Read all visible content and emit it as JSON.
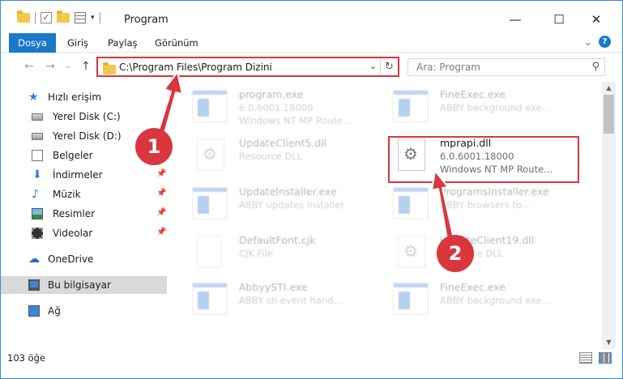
{
  "window": {
    "title": "Program"
  },
  "titlebar": {
    "minimize": "—",
    "maximize": "☐",
    "close": "✕",
    "qat_dropdown": "▾"
  },
  "ribbon": {
    "tabs": [
      "Dosya",
      "Giriş",
      "Paylaş",
      "Görünüm"
    ],
    "expand": "⌄",
    "help": "?"
  },
  "nav": {
    "back": "←",
    "forward": "→",
    "recent": "⌄",
    "up": "↑",
    "address": "C:\\Program Files\\Program Dizini",
    "address_dd": "⌄",
    "refresh": "↻",
    "search_placeholder": "Ara: Program",
    "search_icon": "⚲"
  },
  "sidebar": {
    "quick_access": "Hızlı erişim",
    "items": [
      {
        "label": "Yerel Disk (C:)",
        "pinned": false
      },
      {
        "label": "Yerel Disk (D:)",
        "pinned": false
      },
      {
        "label": "Belgeler",
        "pinned": true
      },
      {
        "label": "İndirmeler",
        "pinned": true
      },
      {
        "label": "Müzik",
        "pinned": true
      },
      {
        "label": "Resimler",
        "pinned": true
      },
      {
        "label": "Videolar",
        "pinned": true
      }
    ],
    "onedrive": "OneDrive",
    "this_pc": "Bu bilgisayar",
    "network": "Ağ",
    "pin_icon": "📌"
  },
  "files": [
    {
      "name": "program.exe",
      "line2": "6.0.6001.18000",
      "line3": "Windows NT MP Route...",
      "type": "exe"
    },
    {
      "name": "FineExec.exe",
      "line2": "ABBY background exe...",
      "line3": "",
      "type": "exe"
    },
    {
      "name": "UpdateClient5.dll",
      "line2": "Resource DLL",
      "line3": "",
      "type": "dll"
    },
    {
      "name": "mprapi.dll",
      "line2": "6.0.6001.18000",
      "line3": "Windows NT MP Route...",
      "type": "dll"
    },
    {
      "name": "UpdateInstaller.exe",
      "line2": "ABBY updates installer",
      "line3": "",
      "type": "exe"
    },
    {
      "name": "ProgramsInstaller.exe",
      "line2": "ABBY browsers to...",
      "line3": "",
      "type": "exe"
    },
    {
      "name": "DefaultFont.cjk",
      "line2": "CJK File",
      "line3": "",
      "type": "cjk"
    },
    {
      "name": "UpdateClient19.dll",
      "line2": "Resource DLL",
      "line3": "",
      "type": "dll"
    },
    {
      "name": "AbbyySTI.exe",
      "line2": "ABBY sti event hand...",
      "line3": "",
      "type": "exe"
    },
    {
      "name": "FineExec.exe",
      "line2": "ABBY background exe...",
      "line3": "",
      "type": "exe"
    }
  ],
  "annotations": {
    "step1": "1",
    "step2": "2"
  },
  "status": {
    "count": "103 öğe"
  },
  "colors": {
    "accent": "#1979ca",
    "highlight": "#d9363e",
    "selected": "#cce8ff"
  }
}
